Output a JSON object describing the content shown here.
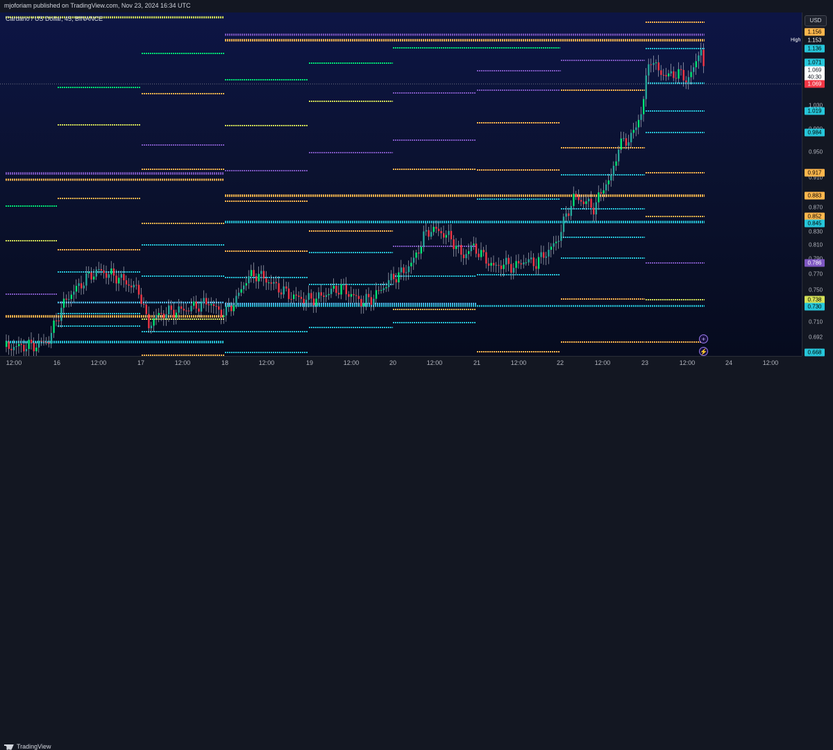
{
  "header": {
    "published": "mjoforiam published on TradingView.com, Nov 23, 2024 16:34 UTC",
    "symbol": "Cardano / US Dollar, 45, BINANCE"
  },
  "currency": "USD",
  "price_ticks": [
    "1.030",
    "0.990",
    "0.950",
    "0.910",
    "0.870",
    "0.830",
    "0.810",
    "0.790",
    "0.770",
    "0.750",
    "0.710",
    "0.692"
  ],
  "high_label": "High",
  "price_tags": [
    {
      "text": "1.156",
      "bg": "#ffb74d",
      "fg": "#000000"
    },
    {
      "text": "1.153",
      "bg": "#131722",
      "fg": "#ffffff"
    },
    {
      "text": "1.136",
      "bg": "#26c6da",
      "fg": "#000000"
    },
    {
      "text": "1.071",
      "bg": "#26c6da",
      "fg": "#000000"
    },
    {
      "text": "1.069",
      "bg": "#ffffff",
      "fg": "#131722"
    },
    {
      "text": "40:30",
      "bg": "#ffffff",
      "fg": "#131722"
    },
    {
      "text": "1.069",
      "bg": "#f23645",
      "fg": "#ffffff"
    },
    {
      "text": "1.019",
      "bg": "#26c6da",
      "fg": "#000000"
    },
    {
      "text": "0.984",
      "bg": "#26c6da",
      "fg": "#000000"
    },
    {
      "text": "0.917",
      "bg": "#ffb74d",
      "fg": "#000000"
    },
    {
      "text": "0.883",
      "bg": "#ffb74d",
      "fg": "#000000"
    },
    {
      "text": "0.852",
      "bg": "#ffb74d",
      "fg": "#000000"
    },
    {
      "text": "0.845",
      "bg": "#26c6da",
      "fg": "#000000"
    },
    {
      "text": "0.786",
      "bg": "#7e57c2",
      "fg": "#ffffff"
    },
    {
      "text": "0.738",
      "bg": "#d4e157",
      "fg": "#000000"
    },
    {
      "text": "0.730",
      "bg": "#26c6da",
      "fg": "#000000"
    },
    {
      "text": "0.668",
      "bg": "#26c6da",
      "fg": "#000000"
    }
  ],
  "time_ticks": [
    "12:00",
    "16",
    "12:00",
    "17",
    "12:00",
    "18",
    "12:00",
    "19",
    "12:00",
    "20",
    "12:00",
    "21",
    "12:00",
    "22",
    "12:00",
    "23",
    "12:00",
    "24",
    "12:00"
  ],
  "branding": "TradingView",
  "buttons": {
    "plus": "+",
    "bolt": "⚡"
  },
  "colors": {
    "background": "#131722",
    "grad_top": "#0d1545",
    "up_candle": "#26a69a",
    "up_bright": "#00e676",
    "down_candle": "#f23645",
    "orange": "#ffb74d",
    "cyan": "#26c6da",
    "purple": "#7e57c2",
    "lime": "#d4e157",
    "green": "#00e676",
    "sky": "#4fc3f7"
  },
  "icons": [
    "tradingview-logo-icon",
    "plus-icon",
    "lightning-icon"
  ]
}
